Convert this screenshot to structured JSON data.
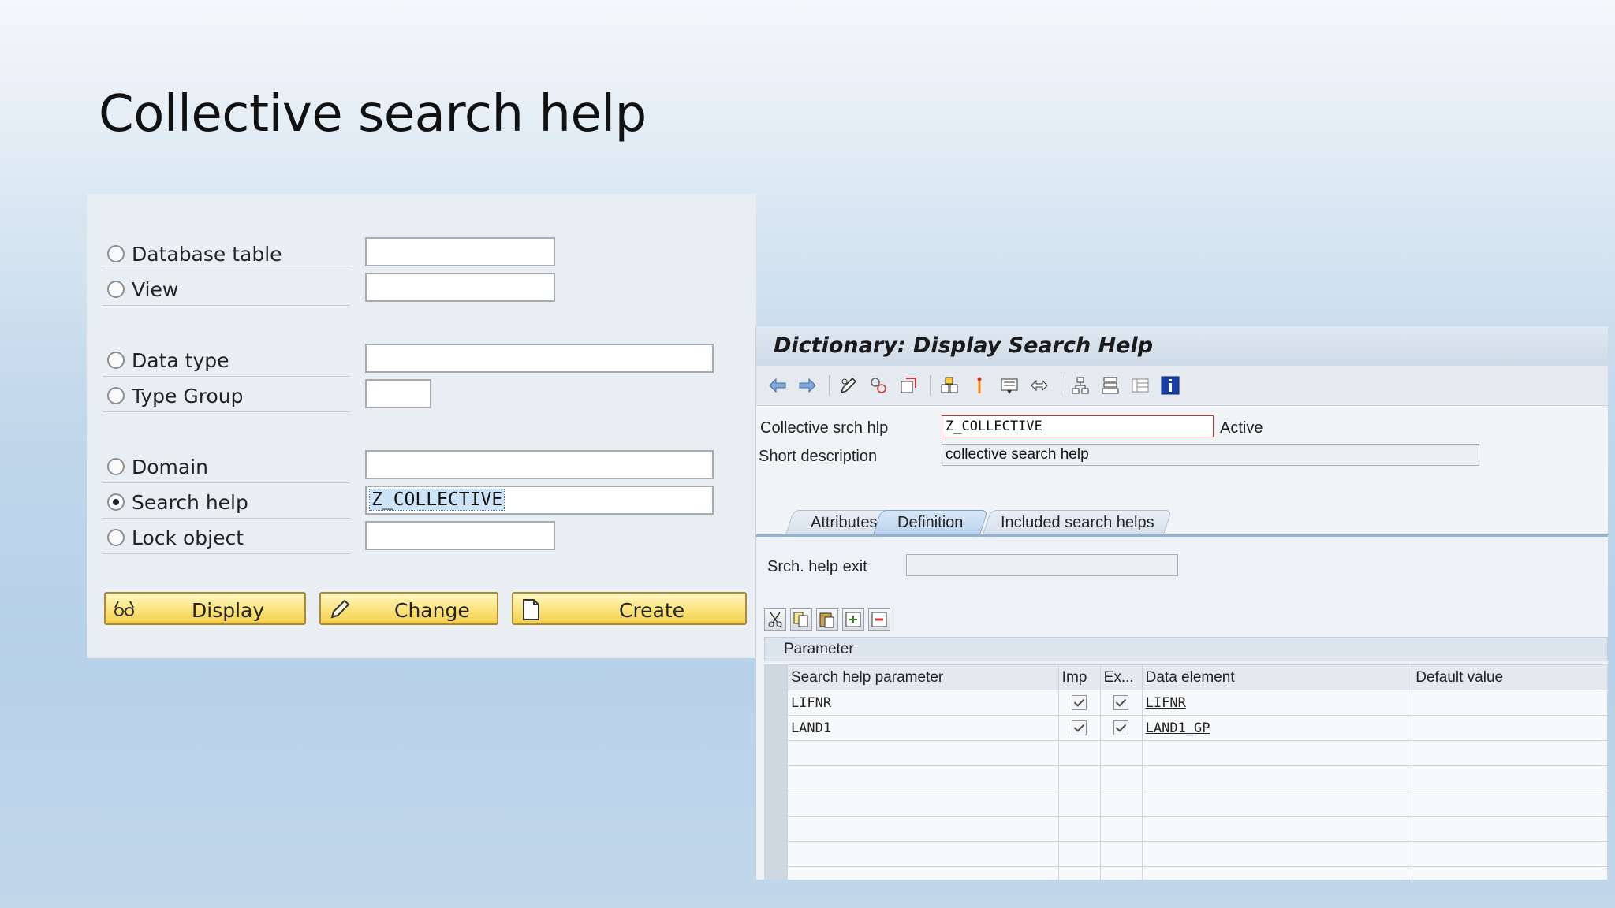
{
  "slide": {
    "title": "Collective search help"
  },
  "initial_screen": {
    "options": [
      {
        "label": "Database table",
        "selected": false,
        "value": ""
      },
      {
        "label": "View",
        "selected": false,
        "value": ""
      },
      {
        "label": "Data type",
        "selected": false,
        "value": ""
      },
      {
        "label": "Type Group",
        "selected": false,
        "value": ""
      },
      {
        "label": "Domain",
        "selected": false,
        "value": ""
      },
      {
        "label": "Search help",
        "selected": true,
        "value": "Z_COLLECTIVE"
      },
      {
        "label": "Lock object",
        "selected": false,
        "value": ""
      }
    ],
    "buttons": {
      "display": "Display",
      "change": "Change",
      "create": "Create"
    }
  },
  "dictionary": {
    "title": "Dictionary: Display Search Help",
    "collective_label": "Collective srch hlp",
    "collective_value": "Z_COLLECTIVE",
    "status": "Active",
    "short_desc_label": "Short description",
    "short_desc_value": "collective search help",
    "tabs": [
      "Attributes",
      "Definition",
      "Included search helps"
    ],
    "active_tab": "Definition",
    "exit_label": "Srch. help exit",
    "exit_value": "",
    "param_section": "Parameter",
    "columns": [
      "Search help parameter",
      "Imp",
      "Ex...",
      "Data element",
      "Default value"
    ],
    "rows": [
      {
        "param": "LIFNR",
        "imp": true,
        "exp": true,
        "element": "LIFNR",
        "default": ""
      },
      {
        "param": "LAND1",
        "imp": true,
        "exp": true,
        "element": "LAND1_GP",
        "default": ""
      }
    ]
  }
}
